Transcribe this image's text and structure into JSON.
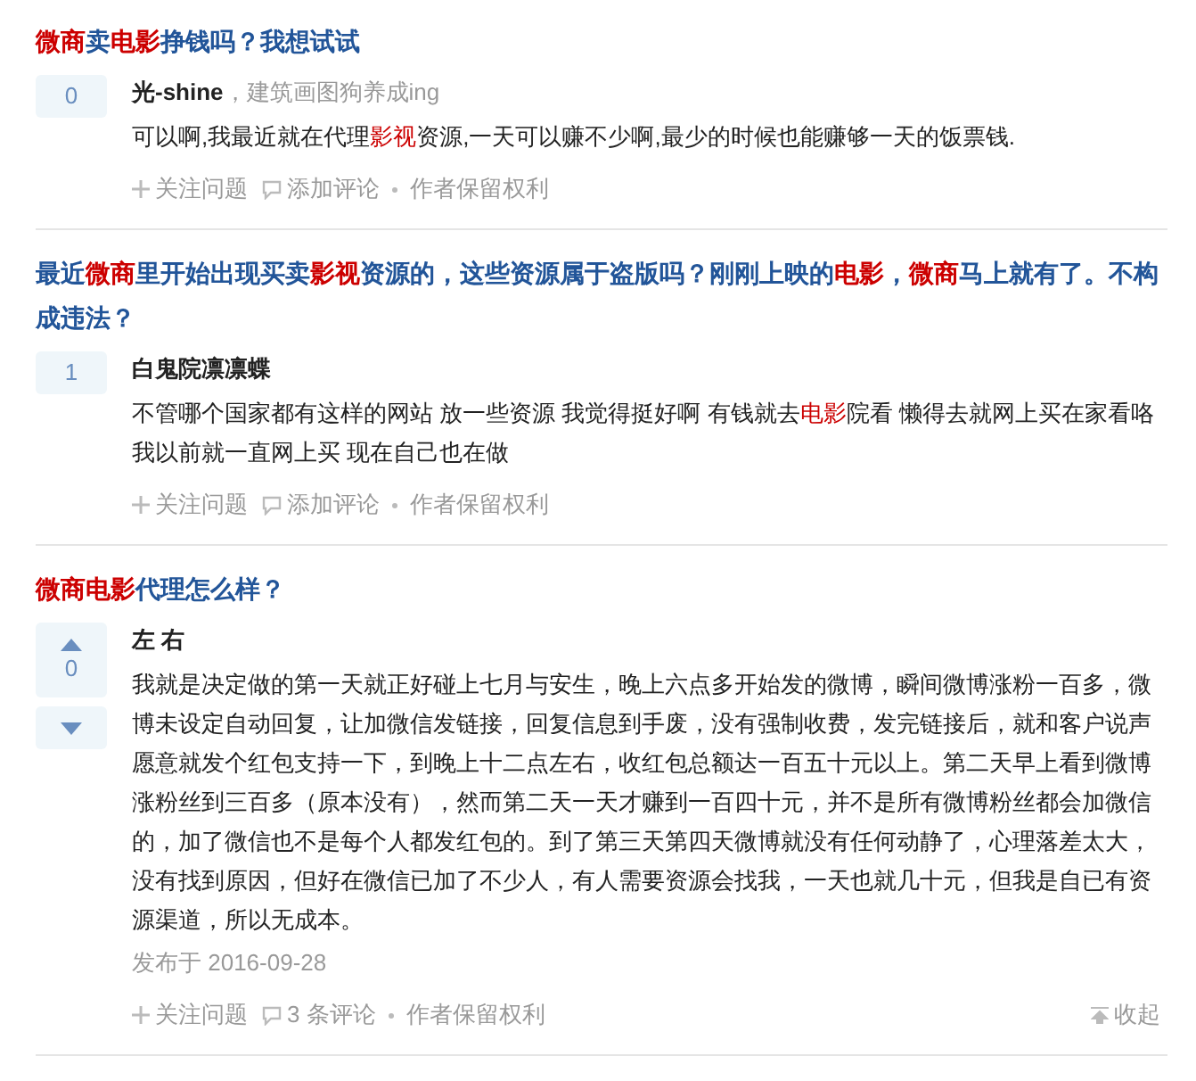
{
  "questions": [
    {
      "title": [
        {
          "text": "微商",
          "highlight": true
        },
        {
          "text": "卖",
          "highlight": false
        },
        {
          "text": "电影",
          "highlight": true
        },
        {
          "text": "挣钱吗？我想试试",
          "highlight": false
        }
      ],
      "vote": {
        "kind": "count",
        "count": "0"
      },
      "author": "光-shine",
      "bio": "，建筑画图狗养成ing",
      "body": [
        {
          "text": "可以啊,我最近就在代理",
          "highlight": false
        },
        {
          "text": "影视",
          "highlight": true
        },
        {
          "text": "资源,一天可以赚不少啊,最少的时候也能赚够一天的饭票钱.",
          "highlight": false
        }
      ],
      "actions": {
        "follow": "关注问题",
        "comment": "添加评论",
        "rights": "作者保留权利"
      }
    },
    {
      "title": [
        {
          "text": "最近",
          "highlight": false
        },
        {
          "text": "微商",
          "highlight": true
        },
        {
          "text": "里开始出现买卖",
          "highlight": false
        },
        {
          "text": "影视",
          "highlight": true
        },
        {
          "text": "资源的，这些资源属于盗版吗？刚刚上映的",
          "highlight": false
        },
        {
          "text": "电影",
          "highlight": true
        },
        {
          "text": "，",
          "highlight": false
        },
        {
          "text": "微商",
          "highlight": true
        },
        {
          "text": "马上就有了。不构成违法？",
          "highlight": false
        }
      ],
      "vote": {
        "kind": "count",
        "count": "1"
      },
      "author": "白鬼院凛凛蝶",
      "body": [
        {
          "text": "不管哪个国家都有这样的网站 放一些资源 我觉得挺好啊 有钱就去",
          "highlight": false
        },
        {
          "text": "电影",
          "highlight": true
        },
        {
          "text": "院看 懒得去就网上买在家看咯我以前就一直网上买 现在自己也在做",
          "highlight": false
        }
      ],
      "actions": {
        "follow": "关注问题",
        "comment": "添加评论",
        "rights": "作者保留权利"
      }
    },
    {
      "title": [
        {
          "text": "微商电影",
          "highlight": true
        },
        {
          "text": "代理怎么样？",
          "highlight": false
        }
      ],
      "vote": {
        "kind": "arrows",
        "count": "0"
      },
      "author": "左 右",
      "body": [
        {
          "text": "我就是决定做的第一天就正好碰上七月与安生，晚上六点多开始发的微博，瞬间微博涨粉一百多，微博未设定自动回复，让加微信发链接，回复信息到手废，没有强制收费，发完链接后，就和客户说声愿意就发个红包支持一下，到晚上十二点左右，收红包总额达一百五十元以上。第二天早上看到微博涨粉丝到三百多（原本没有），然而第二天一天才赚到一百四十元，并不是所有微博粉丝都会加微信的，加了微信也不是每个人都发红包的。到了第三天第四天微博就没有任何动静了，心理落差太大，没有找到原因，但好在微信已加了不少人，有人需要资源会找我，一天也就几十元，但我是自已有资源渠道，所以无成本。",
          "highlight": false
        }
      ],
      "date": "发布于 2016-09-28",
      "actions": {
        "follow": "关注问题",
        "comment": "3 条评论",
        "rights": "作者保留权利",
        "collapse": "收起"
      }
    }
  ]
}
